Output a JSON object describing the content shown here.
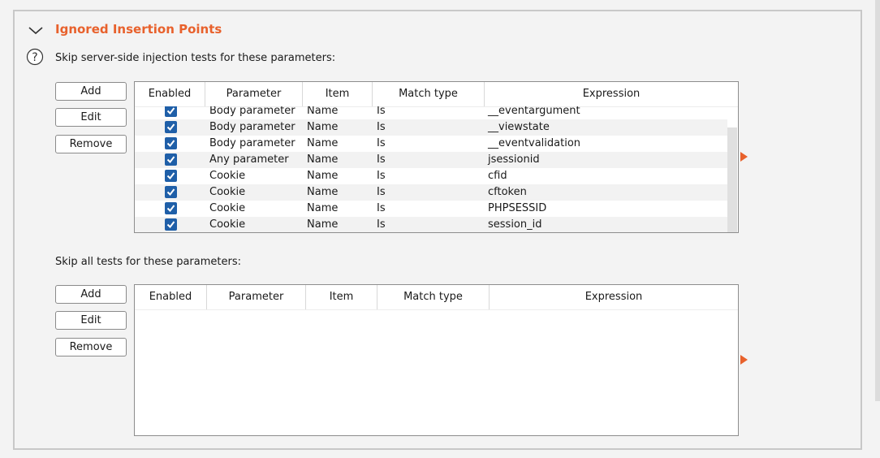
{
  "section": {
    "title": "Ignored Insertion Points",
    "desc1": "Skip server-side injection tests for these parameters:",
    "desc2": "Skip all tests for these parameters:"
  },
  "buttons": {
    "add": "Add",
    "edit": "Edit",
    "remove": "Remove"
  },
  "columns": [
    "Enabled",
    "Parameter",
    "Item",
    "Match type",
    "Expression"
  ],
  "table1": {
    "rows": [
      {
        "enabled": true,
        "parameter": "Body parameter",
        "item": "Name",
        "match": "Is",
        "expression": "__eventargument"
      },
      {
        "enabled": true,
        "parameter": "Body parameter",
        "item": "Name",
        "match": "Is",
        "expression": "__viewstate"
      },
      {
        "enabled": true,
        "parameter": "Body parameter",
        "item": "Name",
        "match": "Is",
        "expression": "__eventvalidation"
      },
      {
        "enabled": true,
        "parameter": "Any parameter",
        "item": "Name",
        "match": "Is",
        "expression": "jsessionid"
      },
      {
        "enabled": true,
        "parameter": "Cookie",
        "item": "Name",
        "match": "Is",
        "expression": "cfid"
      },
      {
        "enabled": true,
        "parameter": "Cookie",
        "item": "Name",
        "match": "Is",
        "expression": "cftoken"
      },
      {
        "enabled": true,
        "parameter": "Cookie",
        "item": "Name",
        "match": "Is",
        "expression": "PHPSESSID"
      },
      {
        "enabled": true,
        "parameter": "Cookie",
        "item": "Name",
        "match": "Is",
        "expression": "session_id"
      }
    ]
  },
  "table2": {
    "rows": []
  },
  "colors": {
    "accent": "#e8612c",
    "checkbox": "#1f5fa8"
  },
  "icons": {
    "collapse": "chevron-down-icon",
    "help": "help-icon",
    "expand": "play-arrow-icon",
    "check": "checkmark-icon"
  }
}
